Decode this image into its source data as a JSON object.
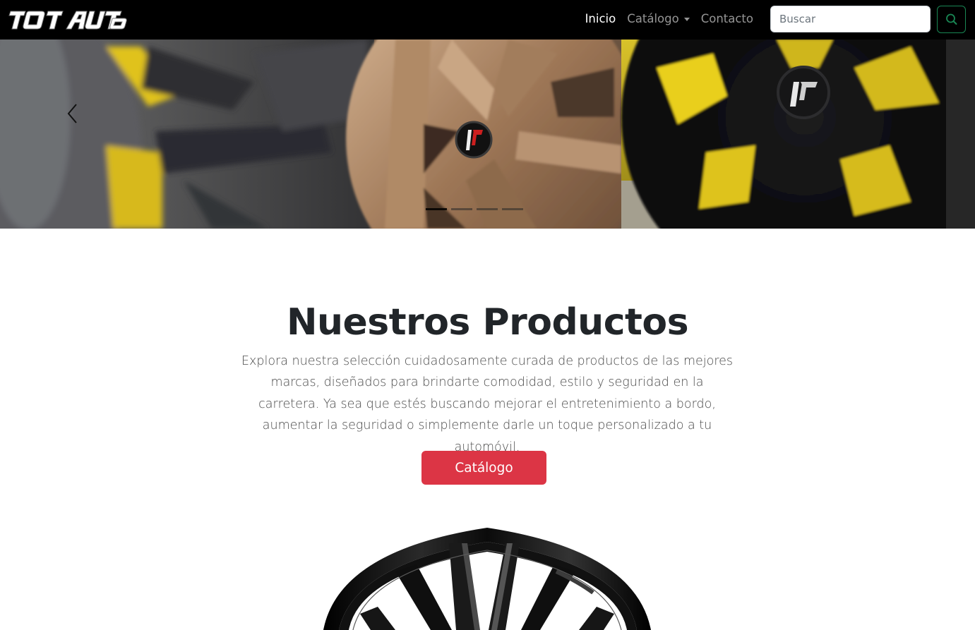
{
  "brand": {
    "logo_text": "TOT AUTO"
  },
  "nav": {
    "items": [
      {
        "label": "Inicio",
        "active": true
      },
      {
        "label": "Catálogo",
        "dropdown": true
      },
      {
        "label": "Contacto"
      }
    ]
  },
  "search": {
    "placeholder": "Buscar",
    "button_icon": "search-icon"
  },
  "carousel": {
    "slide_count": 4,
    "active_slide": 1,
    "prev_icon": "chevron-left-icon"
  },
  "products": {
    "title": "Nuestros Productos",
    "description": "Explora nuestra selección cuidadosamente curada de productos de las mejores marcas, diseñados para brindarte comodidad, estilo y seguridad en la carretera. Ya sea que estés buscando mejorar el entretenimiento a bordo, aumentar la seguridad o simplemente darle un toque personalizado a tu automóvil.",
    "button_label": "Catálogo"
  },
  "colors": {
    "navbar_bg": "#000000",
    "search_button_border": "#198754",
    "catalog_button_bg": "#dc3545",
    "title_text": "#212529"
  }
}
